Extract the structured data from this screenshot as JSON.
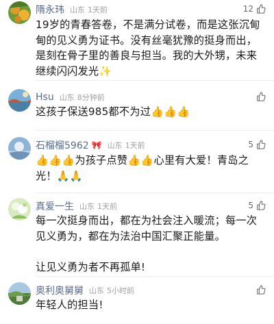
{
  "comments": [
    {
      "name": "隋永玮",
      "location": "山东",
      "time": "1天前",
      "likes": "12",
      "text": "19岁的青春答卷，不是满分试卷，而是这张沉甸甸的见义勇为证书。没有丝毫犹豫的挺身而出，是刻在骨子里的善良与担当。我的大外甥，未来继续闪闪发光✨"
    },
    {
      "name": "Hsu",
      "location": "山东",
      "time": "8分钟前",
      "likes": "",
      "text": "这孩子保送985都不为过👍👍👍"
    },
    {
      "name": "石榴榴5962",
      "badge": "🎀",
      "location": "山东",
      "time": "1天前",
      "likes": "5",
      "text": "👍👍👍为孩子点赞👍👍心里有大爱！青岛之光！🙏🙏"
    },
    {
      "name": "真爱一生",
      "location": "山东",
      "time": "1天前",
      "likes": "5",
      "text": "每一次挺身而出，都在为社会注入暖流；每一次见义勇为，都在为法治中国汇聚正能量。\n\n让见义勇为者不再孤单!"
    },
    {
      "name": "奥利奥舅舅",
      "location": "山东",
      "time": "5小时前",
      "likes": "",
      "text": "年轻人的担当!"
    }
  ],
  "icons": {
    "like": "thumb-up-outline-icon"
  },
  "colors": {
    "username": "#5b6b8c",
    "meta": "#a0a0a0",
    "text": "#1a1a1a"
  }
}
